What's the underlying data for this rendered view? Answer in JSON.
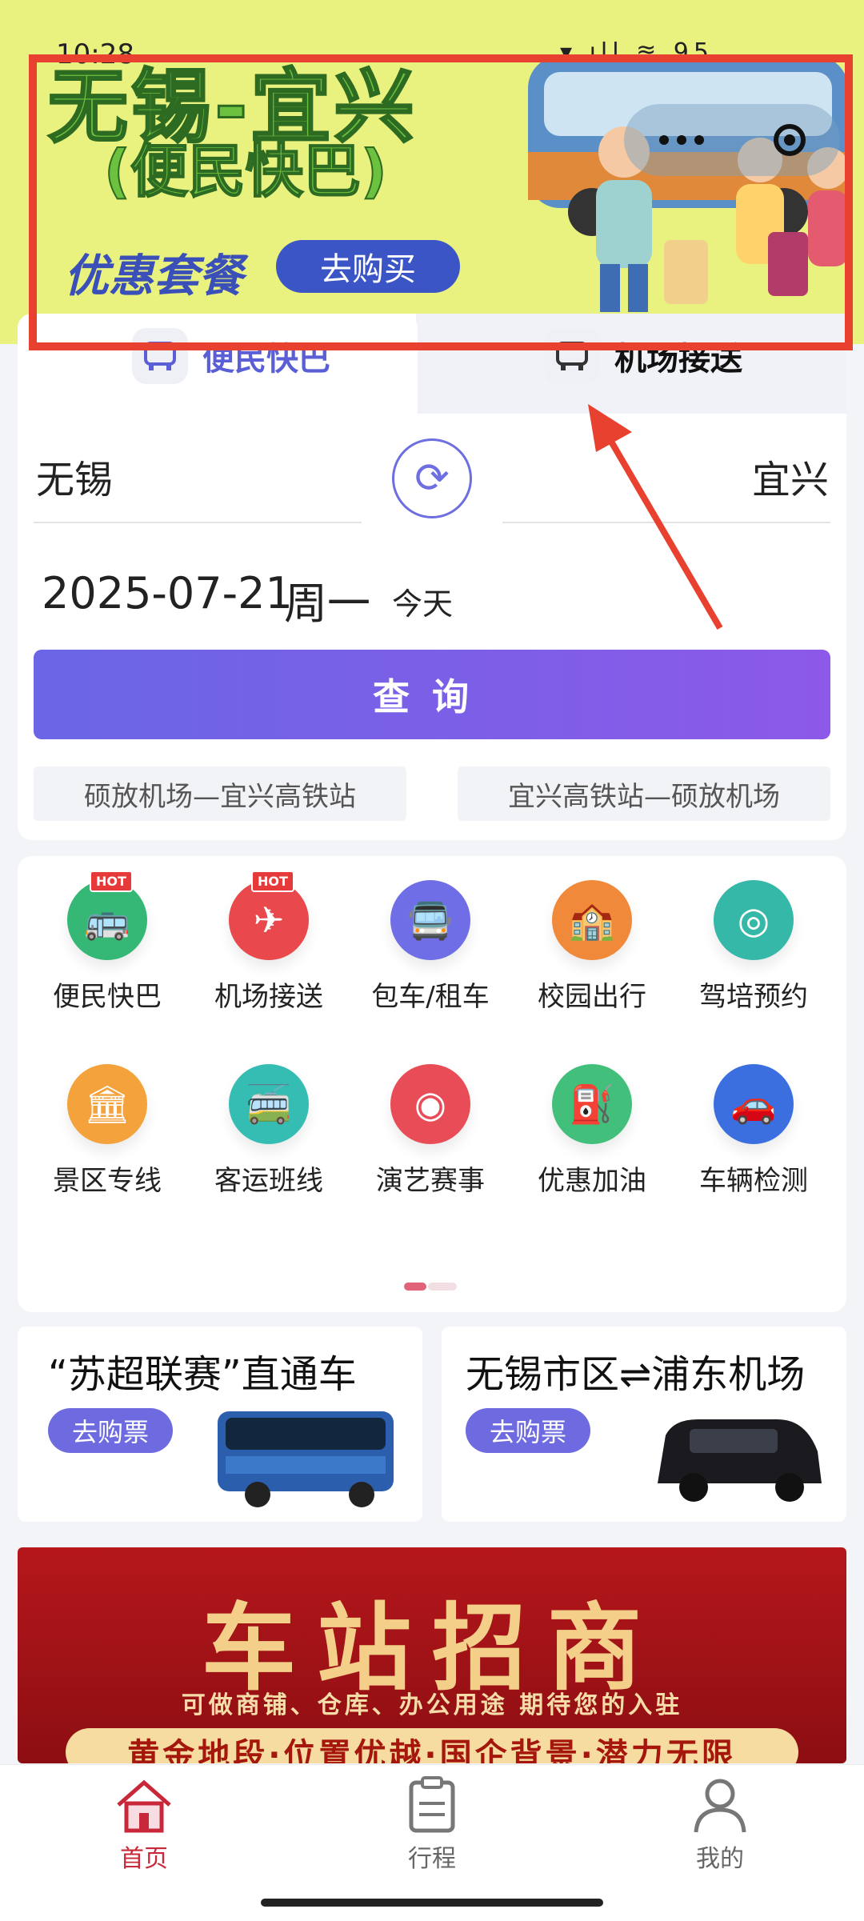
{
  "status_bar": {
    "time": "10:28",
    "right": "▾ ıll ≋ 95"
  },
  "banner": {
    "title": "无锡-宜兴",
    "subtitle": "(便民快巴)",
    "promo": "优惠套餐",
    "buy_button": "去购买"
  },
  "tabs": [
    {
      "label": "便民快巴",
      "active": true
    },
    {
      "label": "机场接送",
      "active": false
    }
  ],
  "search": {
    "from_city": "无锡",
    "to_city": "宜兴",
    "swap_icon": "⟳",
    "date": "2025-07-21",
    "weekday": "周一",
    "today": "今天",
    "query_button": "查询",
    "routes": [
      "硕放机场—宜兴高铁站",
      "宜兴高铁站—硕放机场"
    ]
  },
  "services": [
    {
      "label": "便民快巴",
      "icon": "bus-icon",
      "glyph": "🚌",
      "color": "#35b875",
      "hot": true
    },
    {
      "label": "机场接送",
      "icon": "plane-icon",
      "glyph": "✈",
      "color": "#e9484c",
      "hot": true
    },
    {
      "label": "包车/租车",
      "icon": "coach-icon",
      "glyph": "🚍",
      "color": "#6f6ee6",
      "hot": false
    },
    {
      "label": "校园出行",
      "icon": "school-icon",
      "glyph": "🏫",
      "color": "#f08a3a",
      "hot": false
    },
    {
      "label": "驾培预约",
      "icon": "steering-wheel-icon",
      "glyph": "◎",
      "color": "#35b8a8",
      "hot": false
    },
    {
      "label": "景区专线",
      "icon": "scenic-icon",
      "glyph": "🏛",
      "color": "#f3a23c",
      "hot": false
    },
    {
      "label": "客运班线",
      "icon": "bus-line-icon",
      "glyph": "🚎",
      "color": "#36bdb3",
      "hot": false
    },
    {
      "label": "演艺赛事",
      "icon": "show-icon",
      "glyph": "◉",
      "color": "#e84c57",
      "hot": false
    },
    {
      "label": "优惠加油",
      "icon": "fuel-icon",
      "glyph": "⛽",
      "color": "#42c07b",
      "hot": false
    },
    {
      "label": "车辆检测",
      "icon": "car-icon",
      "glyph": "🚗",
      "color": "#3b6fe0",
      "hot": false
    }
  ],
  "hot_badge": "HOT",
  "promos": [
    {
      "title": "“苏超联赛”直通车",
      "button": "去购票"
    },
    {
      "title": "无锡市区⇌浦东机场",
      "button": "去购票"
    }
  ],
  "merchant": {
    "title": "车站招商",
    "subtitle": "可做商铺、仓库、办公用途 期待您的入驻",
    "strip": "黄金地段·位置优越·国企背景·潜力无限"
  },
  "nav": [
    {
      "label": "首页",
      "icon": "home-icon",
      "active": true
    },
    {
      "label": "行程",
      "icon": "clipboard-icon",
      "active": false
    },
    {
      "label": "我的",
      "icon": "user-icon",
      "active": false
    }
  ],
  "colors": {
    "accent": "#6a66e6",
    "nav_active": "#c9283b",
    "highlight": "#e8412f"
  }
}
